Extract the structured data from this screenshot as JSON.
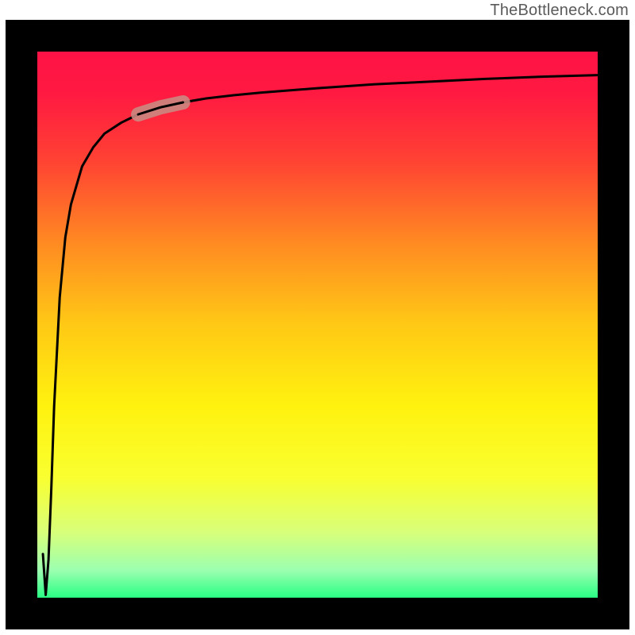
{
  "attribution": {
    "text": "TheBottleneck.com"
  },
  "chart_data": {
    "type": "line",
    "title": "",
    "xlabel": "",
    "ylabel": "",
    "xlim": [
      0,
      100
    ],
    "ylim": [
      0,
      100
    ],
    "series": [
      {
        "name": "curve",
        "x": [
          1,
          1.5,
          2,
          2.5,
          3,
          4,
          5,
          6,
          8,
          10,
          12,
          15,
          18,
          22,
          26,
          30,
          35,
          40,
          50,
          60,
          70,
          80,
          90,
          100
        ],
        "y": [
          8,
          0.5,
          7,
          20,
          35,
          55,
          66,
          72,
          79,
          82.5,
          85,
          87,
          88.5,
          89.8,
          90.7,
          91.4,
          92,
          92.5,
          93.3,
          94,
          94.5,
          95,
          95.4,
          95.7
        ]
      }
    ],
    "highlight_segment": {
      "series": "curve",
      "x_range": [
        18,
        26
      ]
    },
    "background": {
      "gradient_stops": [
        {
          "offset": 0.0,
          "color": "#ff1246"
        },
        {
          "offset": 0.08,
          "color": "#ff1a41"
        },
        {
          "offset": 0.2,
          "color": "#ff4233"
        },
        {
          "offset": 0.35,
          "color": "#ff8a22"
        },
        {
          "offset": 0.5,
          "color": "#ffc915"
        },
        {
          "offset": 0.65,
          "color": "#fff20f"
        },
        {
          "offset": 0.78,
          "color": "#f9ff30"
        },
        {
          "offset": 0.88,
          "color": "#d8ff7a"
        },
        {
          "offset": 0.95,
          "color": "#9bffb0"
        },
        {
          "offset": 1.0,
          "color": "#29ff84"
        }
      ]
    },
    "frame": {
      "outer_x": 7,
      "outer_y": 25,
      "outer_w": 786,
      "outer_h": 768,
      "border_width": 40,
      "border_color": "#000000"
    }
  }
}
